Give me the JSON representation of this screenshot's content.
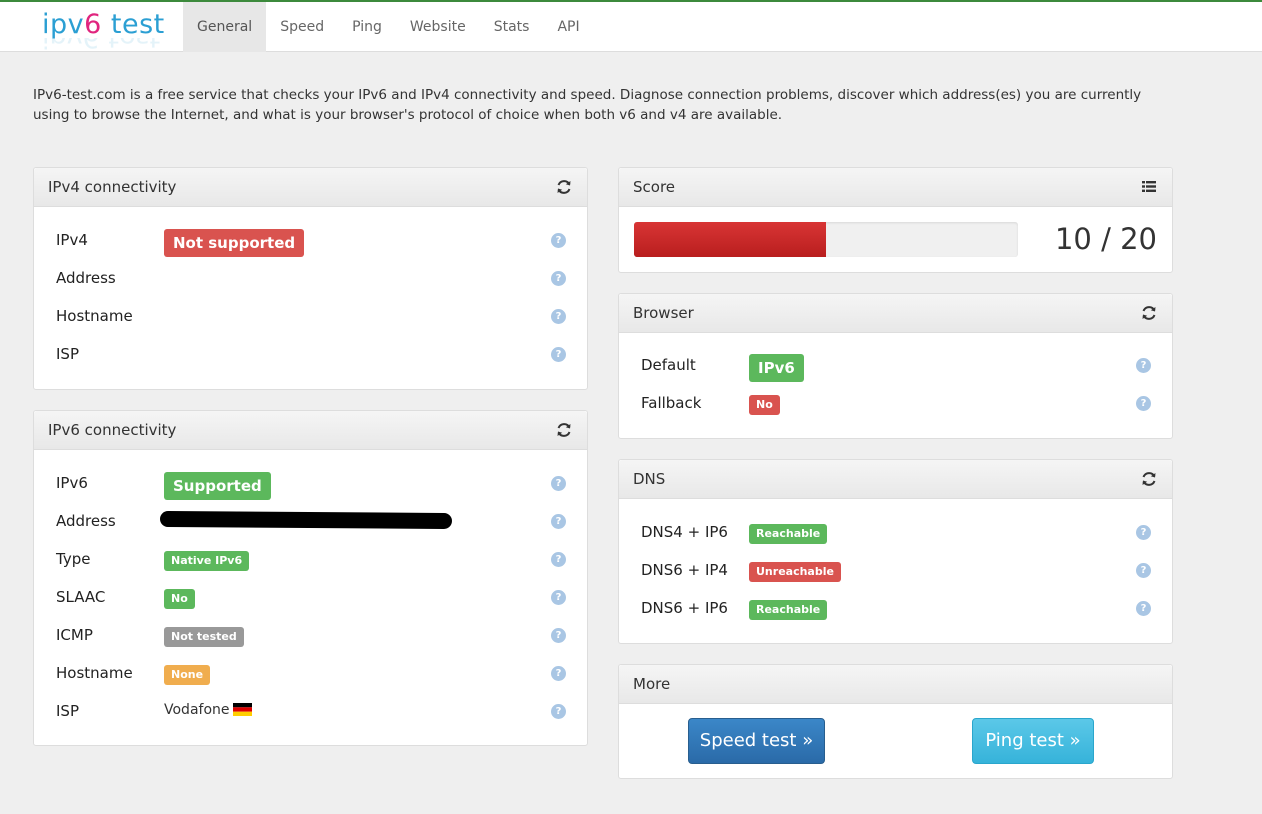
{
  "logo": {
    "part1": "ipv",
    "part2": "6",
    "part3": " test"
  },
  "nav": [
    "General",
    "Speed",
    "Ping",
    "Website",
    "Stats",
    "API"
  ],
  "intro": "IPv6-test.com is a free service that checks your IPv6 and IPv4 connectivity and speed. Diagnose connection problems, discover which address(es) you are currently using to browse the Internet, and what is your browser's protocol of choice when both v6 and v4 are available.",
  "ipv4": {
    "title": "IPv4 connectivity",
    "rows": [
      {
        "label": "IPv4",
        "value": "Not supported"
      },
      {
        "label": "Address",
        "value": ""
      },
      {
        "label": "Hostname",
        "value": ""
      },
      {
        "label": "ISP",
        "value": ""
      }
    ]
  },
  "ipv6": {
    "title": "IPv6 connectivity",
    "rows": [
      {
        "label": "IPv6",
        "value": "Supported"
      },
      {
        "label": "Address",
        "value": ""
      },
      {
        "label": "Type",
        "value": "Native IPv6"
      },
      {
        "label": "SLAAC",
        "value": "No"
      },
      {
        "label": "ICMP",
        "value": "Not tested"
      },
      {
        "label": "Hostname",
        "value": "None"
      },
      {
        "label": "ISP",
        "value": "Vodafone"
      }
    ]
  },
  "score": {
    "title": "Score",
    "value": 10,
    "max": 20,
    "text": "10 / 20",
    "bar_color": "#c9302c"
  },
  "browser": {
    "title": "Browser",
    "rows": [
      {
        "label": "Default",
        "value": "IPv6"
      },
      {
        "label": "Fallback",
        "value": "No"
      }
    ]
  },
  "dns": {
    "title": "DNS",
    "rows": [
      {
        "label": "DNS4 + IP6",
        "value": "Reachable"
      },
      {
        "label": "DNS6 + IP4",
        "value": "Unreachable"
      },
      {
        "label": "DNS6 + IP6",
        "value": "Reachable"
      }
    ]
  },
  "more": {
    "title": "More",
    "speed_btn": "Speed test »",
    "ping_btn": "Ping test »"
  },
  "help_glyph": "?",
  "colors": {
    "success": "#5cb85c",
    "danger": "#d9534f",
    "warning": "#f0ad4e",
    "muted": "#999999",
    "primary": "#337ab7",
    "info": "#5bc0de"
  },
  "icons": {
    "refresh": "refresh-icon",
    "list": "list-icon",
    "help": "help-icon",
    "flag": "germany-flag-icon"
  }
}
